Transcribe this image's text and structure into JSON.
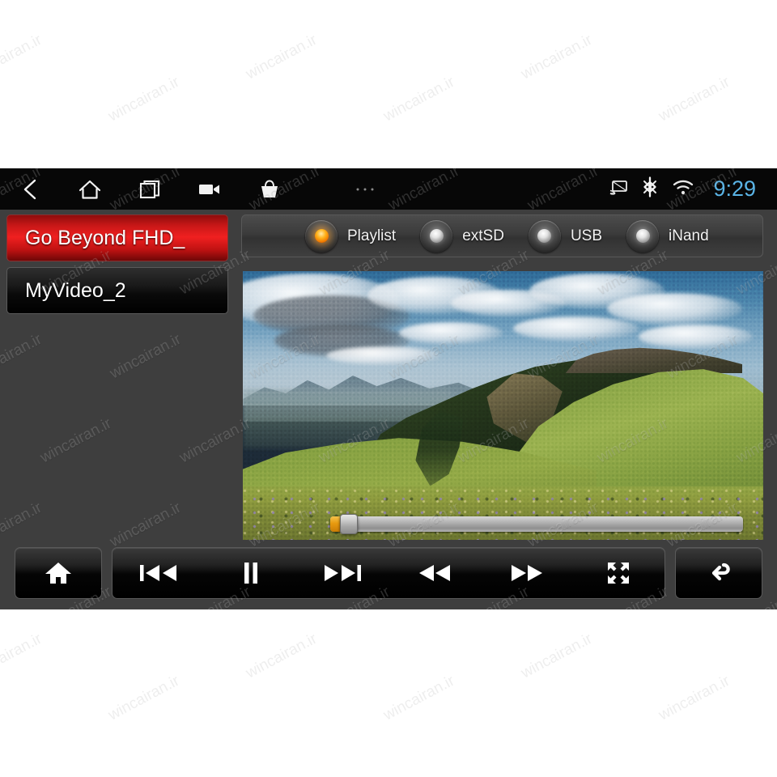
{
  "watermark": {
    "text": "wincairan.ir"
  },
  "statusbar": {
    "icons": [
      {
        "name": "back-icon",
        "label": "Back"
      },
      {
        "name": "home-icon",
        "label": "Home"
      },
      {
        "name": "recents-icon",
        "label": "Recent apps"
      },
      {
        "name": "video-camera-icon",
        "label": "Video"
      },
      {
        "name": "basket-icon",
        "label": "Apps"
      },
      {
        "name": "more-options-icon",
        "label": "More"
      }
    ],
    "tray": [
      {
        "name": "cast-icon",
        "label": "Cast"
      },
      {
        "name": "bluetooth-icon",
        "label": "Bluetooth"
      },
      {
        "name": "wifi-icon",
        "label": "Wi-Fi"
      }
    ],
    "clock": "9:29",
    "clock_color": "#5ab4e6"
  },
  "playlist": {
    "items": [
      {
        "title": "Go Beyond FHD_",
        "selected": true
      },
      {
        "title": "MyVideo_2",
        "selected": false
      }
    ]
  },
  "sources": {
    "options": [
      {
        "label": "Playlist",
        "selected": true
      },
      {
        "label": "extSD",
        "selected": false
      },
      {
        "label": "USB",
        "selected": false
      },
      {
        "label": "iNand",
        "selected": false
      }
    ],
    "active_led_color": "#ffb21a",
    "inactive_led_color": "#e2e2e2"
  },
  "player": {
    "now_playing": "Go Beyond FHD_",
    "progress_percent": 3,
    "state": "playing",
    "seek_fill_color": "#e79a10"
  },
  "transport": {
    "buttons": [
      {
        "name": "home-button",
        "label": "Home"
      },
      {
        "name": "previous-track-button",
        "label": "Previous"
      },
      {
        "name": "pause-button",
        "label": "Pause"
      },
      {
        "name": "next-track-button",
        "label": "Next"
      },
      {
        "name": "rewind-button",
        "label": "Rewind"
      },
      {
        "name": "fast-forward-button",
        "label": "Fast forward"
      },
      {
        "name": "fullscreen-button",
        "label": "Fullscreen"
      },
      {
        "name": "back-button",
        "label": "Back"
      }
    ]
  }
}
